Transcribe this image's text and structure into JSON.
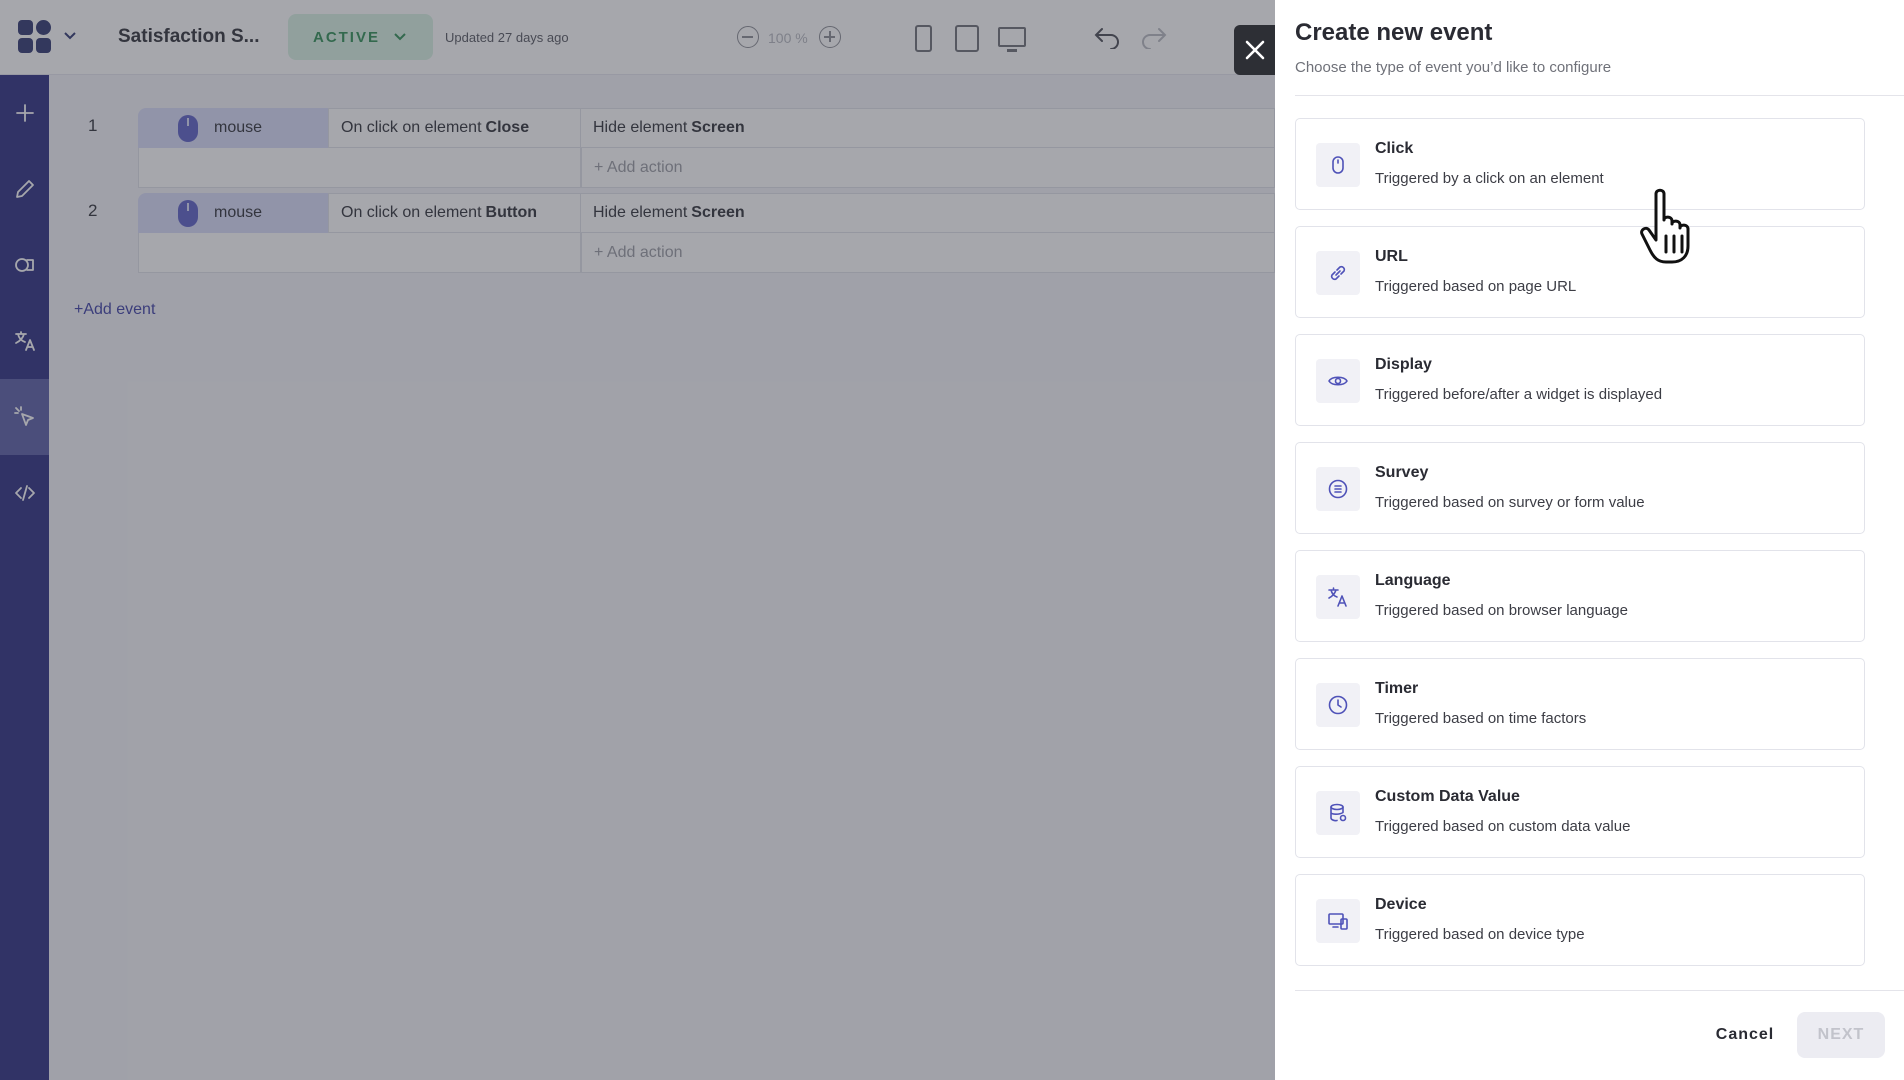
{
  "app": {
    "title": "Satisfaction S...",
    "status_label": "ACTIVE",
    "updated_text": "Updated 27 days ago",
    "zoom_level": "100 %"
  },
  "events": [
    {
      "number": "1",
      "trigger_chip": "mouse",
      "trigger_text": "On click on element",
      "trigger_target": "Close",
      "action_text": "Hide element",
      "action_target": "Screen",
      "add_action_label": "+ Add action"
    },
    {
      "number": "2",
      "trigger_chip": "mouse",
      "trigger_text": "On click on element",
      "trigger_target": "Button",
      "action_text": "Hide element",
      "action_target": "Screen",
      "add_action_label": "+ Add action"
    }
  ],
  "add_event_label": "+Add event",
  "sidebar": {
    "items": [
      {
        "icon": "plus-icon"
      },
      {
        "icon": "pencil-icon"
      },
      {
        "icon": "shapes-icon"
      },
      {
        "icon": "translate-icon"
      },
      {
        "icon": "cursor-click-icon",
        "active": true
      },
      {
        "icon": "code-icon"
      }
    ]
  },
  "drawer": {
    "title": "Create new event",
    "subtitle": "Choose the type of event you’d like to configure",
    "options": [
      {
        "icon": "mouse-icon",
        "title": "Click",
        "description": "Triggered by a click on an element"
      },
      {
        "icon": "link-icon",
        "title": "URL",
        "description": "Triggered based on page URL"
      },
      {
        "icon": "eye-icon",
        "title": "Display",
        "description": "Triggered before/after a widget is displayed"
      },
      {
        "icon": "list-icon",
        "title": "Survey",
        "description": "Triggered based on survey or form value"
      },
      {
        "icon": "translate-icon",
        "title": "Language",
        "description": "Triggered based on browser language"
      },
      {
        "icon": "clock-icon",
        "title": "Timer",
        "description": "Triggered based on time factors"
      },
      {
        "icon": "database-icon",
        "title": "Custom Data Value",
        "description": "Triggered based on custom data value"
      },
      {
        "icon": "devices-icon",
        "title": "Device",
        "description": "Triggered based on device type"
      }
    ],
    "cancel_label": "Cancel",
    "next_label": "NEXT"
  },
  "colors": {
    "rail": "#2a2d80",
    "accent": "#4f52b8",
    "status_green": "#2f8f55",
    "overlay": "rgba(58,60,72,0.45)"
  }
}
